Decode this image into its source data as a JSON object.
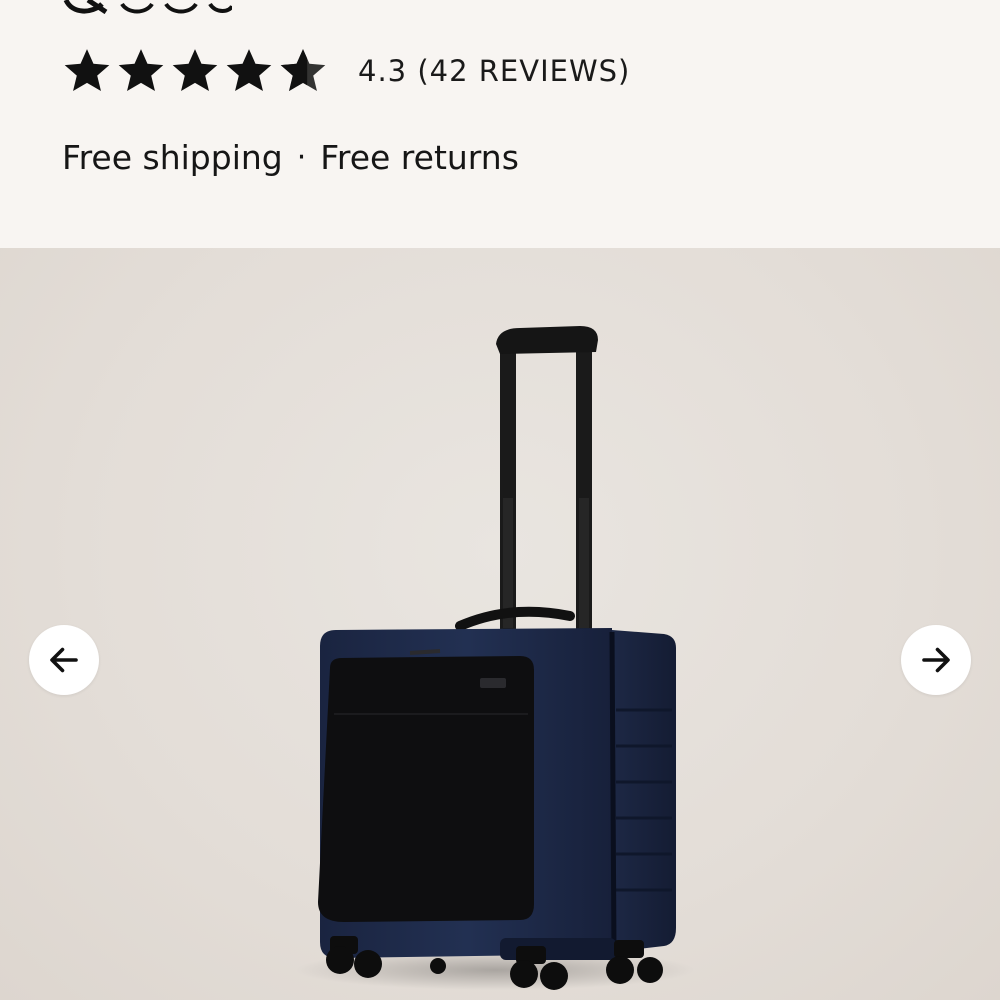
{
  "product": {
    "rating": {
      "stars_filled": 4.3,
      "stars_total": 5,
      "text": "4.3 (42 REVIEWS)"
    },
    "shipping": {
      "free_shipping": "Free shipping",
      "separator": "·",
      "free_returns": "Free returns"
    }
  },
  "gallery": {
    "image_subject": "navy carry-on suitcase with black front laptop pocket and telescoping handle",
    "prev_icon": "arrow-left-icon",
    "next_icon": "arrow-right-icon"
  },
  "colors": {
    "background": "#f8f5f2",
    "star": "#111111",
    "suitcase_body": "#1c2640",
    "front_pocket": "#0d0d0f"
  }
}
